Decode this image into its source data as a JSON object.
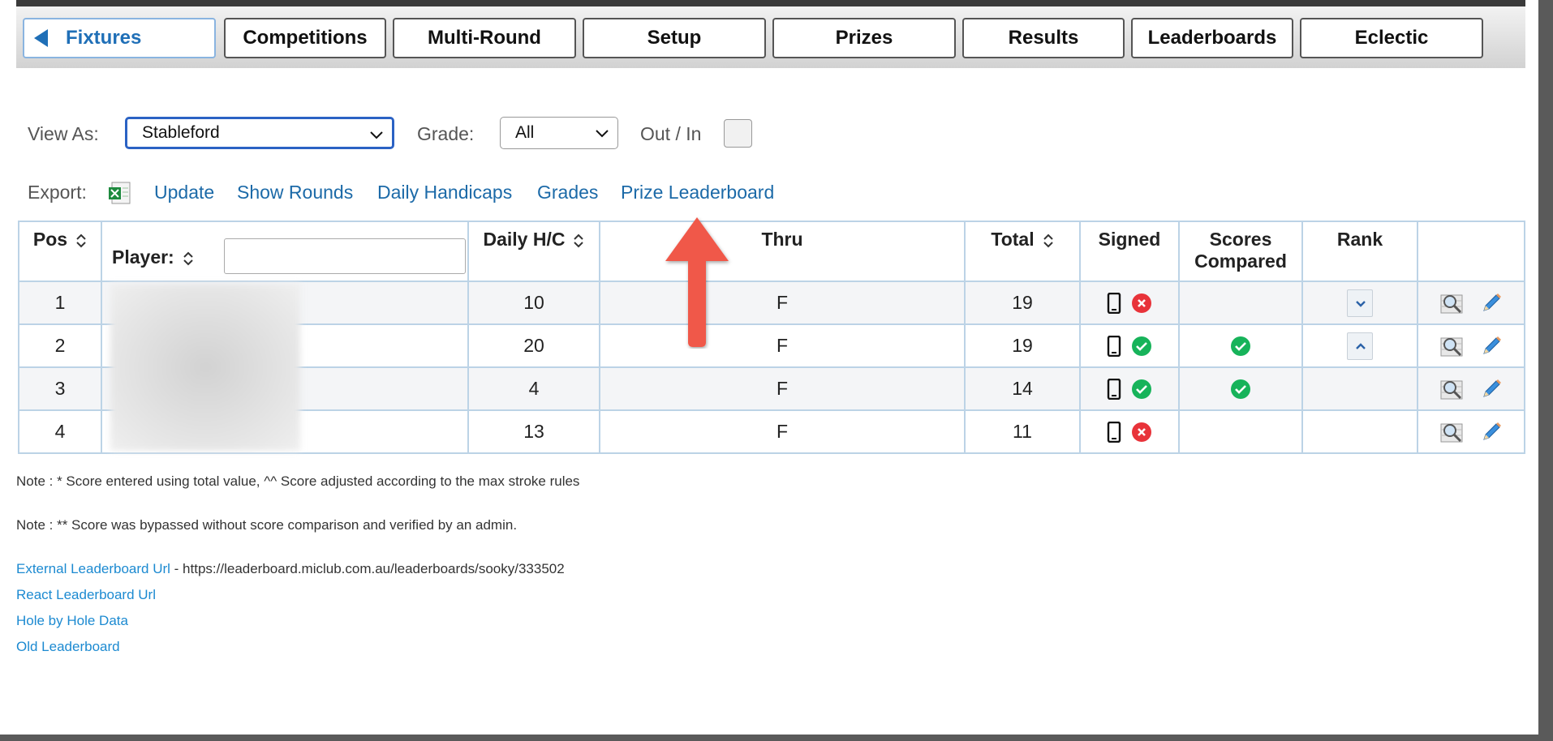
{
  "tabs": [
    {
      "label": "Fixtures",
      "active": true
    },
    {
      "label": "Competitions"
    },
    {
      "label": "Multi-Round"
    },
    {
      "label": "Setup"
    },
    {
      "label": "Prizes"
    },
    {
      "label": "Results"
    },
    {
      "label": "Leaderboards"
    },
    {
      "label": "Eclectic"
    }
  ],
  "filters": {
    "view_as_label": "View As:",
    "view_as_value": "Stableford",
    "grade_label": "Grade:",
    "grade_value": "All",
    "out_in_label": "Out / In"
  },
  "export": {
    "label": "Export:",
    "links": [
      "Update",
      "Show Rounds",
      "Daily Handicaps",
      "Grades",
      "Prize Leaderboard"
    ]
  },
  "table": {
    "headers": {
      "pos": "Pos",
      "player": "Player:",
      "daily_hc": "Daily H/C",
      "thru": "Thru",
      "total": "Total",
      "signed": "Signed",
      "scores_compared": "Scores Compared",
      "rank": "Rank"
    },
    "rows": [
      {
        "pos": "1",
        "daily_hc": "10",
        "thru": "F",
        "total": "19",
        "signed_status": "error",
        "compared": false,
        "rank_control": "down"
      },
      {
        "pos": "2",
        "daily_hc": "20",
        "thru": "F",
        "total": "19",
        "signed_status": "ok",
        "compared": true,
        "rank_control": "up"
      },
      {
        "pos": "3",
        "daily_hc": "4",
        "thru": "F",
        "total": "14",
        "signed_status": "ok",
        "compared": true,
        "rank_control": "none"
      },
      {
        "pos": "4",
        "daily_hc": "13",
        "thru": "F",
        "total": "11",
        "signed_status": "error",
        "compared": false,
        "rank_control": "none"
      }
    ]
  },
  "notes": {
    "note1": "Note : * Score entered using total value, ^^ Score adjusted according to the max stroke rules",
    "note2": "Note : ** Score was bypassed without score comparison and verified by an admin.",
    "external_link": "External Leaderboard Url",
    "external_url_text": " - https://leaderboard.miclub.com.au/leaderboards/sooky/333502",
    "react_link": "React Leaderboard Url",
    "hole_link": "Hole by Hole Data",
    "old_link": "Old Leaderboard"
  },
  "colors": {
    "link": "#1c6aa8",
    "ok_green": "#17b35a",
    "error_red": "#e8333a",
    "annotation_arrow": "#f0584a"
  }
}
